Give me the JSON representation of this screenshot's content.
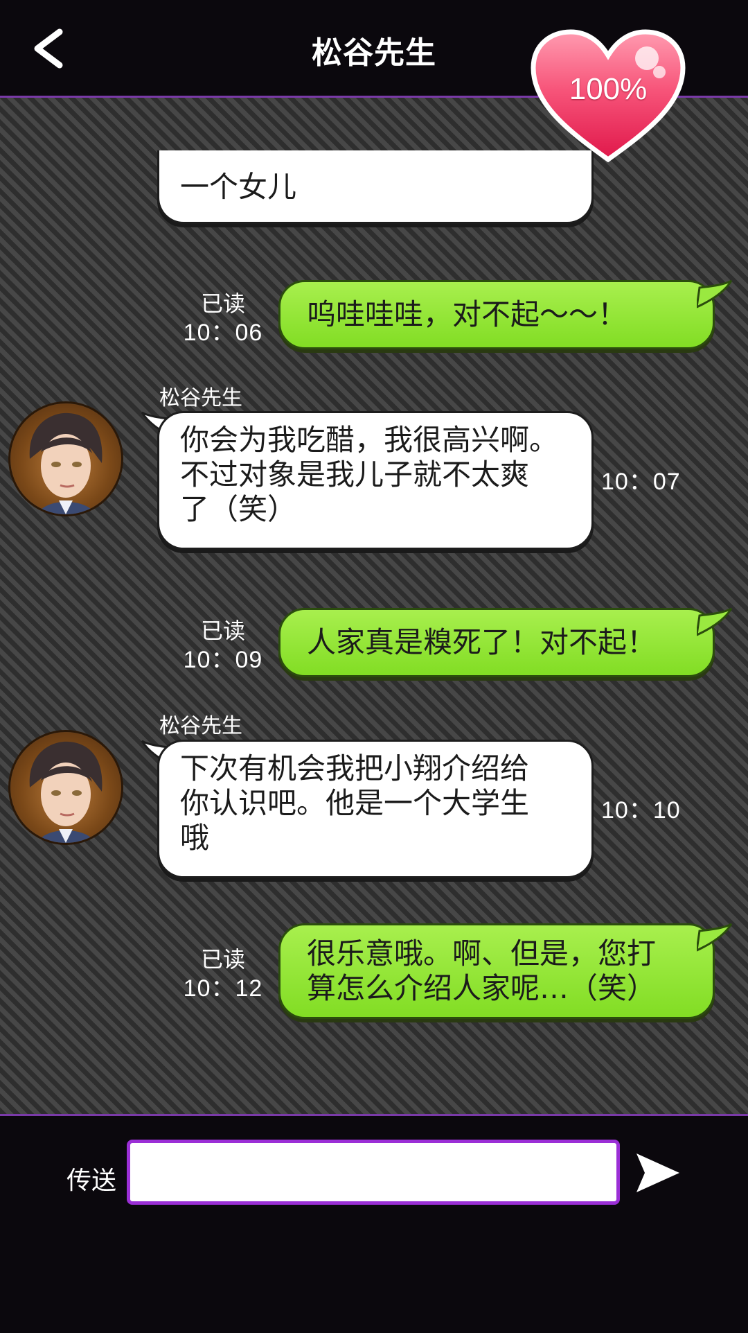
{
  "header": {
    "title": "松谷先生",
    "affection": "100%"
  },
  "messages": [
    {
      "type": "received_partial",
      "text": "一个女儿"
    },
    {
      "type": "sent",
      "read": "已读",
      "time": "10：06",
      "text": "呜哇哇哇，对不起～～！"
    },
    {
      "type": "received",
      "sender": "松谷先生",
      "time": "10：07",
      "lines": [
        "你会为我吃醋，我很高兴啊。",
        "不过对象是我儿子就不太爽",
        "了（笑）"
      ]
    },
    {
      "type": "sent",
      "read": "已读",
      "time": "10：09",
      "text": "人家真是糗死了！对不起！"
    },
    {
      "type": "received",
      "sender": "松谷先生",
      "time": "10：10",
      "lines": [
        "下次有机会我把小翔介绍给",
        "你认识吧。他是一个大学生",
        "哦"
      ]
    },
    {
      "type": "sent",
      "read": "已读",
      "time": "10：12",
      "lines": [
        "很乐意哦。啊、但是，您打",
        "算怎么介绍人家呢…（笑）"
      ]
    }
  ],
  "input": {
    "label": "传送",
    "value": ""
  },
  "icons": {
    "back": "back-chevron-icon",
    "send": "send-arrow-icon",
    "heart": "heart-icon"
  },
  "colors": {
    "accent": "#9b2fd6",
    "sent_bubble": "#8fe52f",
    "heart": "#f0426c"
  }
}
